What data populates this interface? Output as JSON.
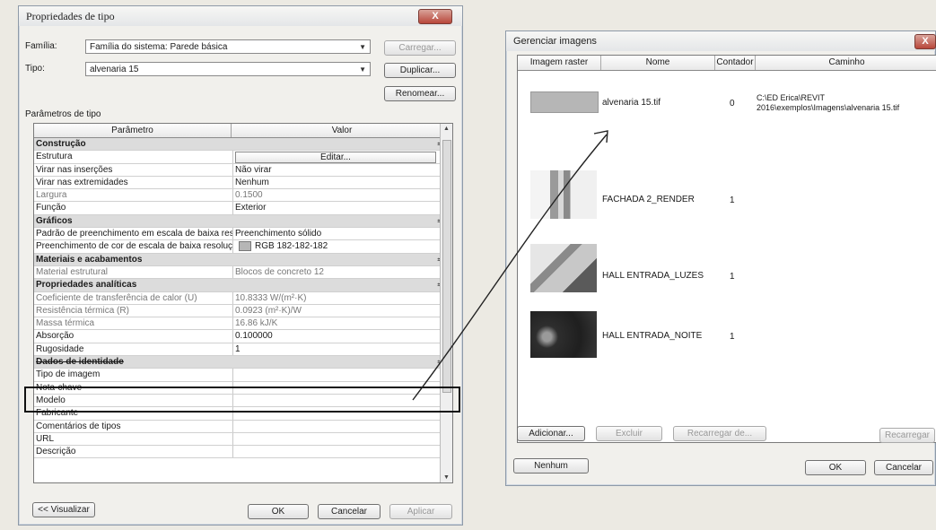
{
  "type_properties": {
    "title": "Propriedades de tipo",
    "close_label": "X",
    "family_label": "Família:",
    "family_value": "Família do sistema: Parede básica",
    "type_label": "Tipo:",
    "type_value": "alvenaria 15",
    "load_button": "Carregar...",
    "duplicate_button": "Duplicar...",
    "rename_button": "Renomear...",
    "section_label": "Parâmetros de tipo",
    "col_parameter": "Parâmetro",
    "col_value": "Valor",
    "groups": {
      "construcao": "Construção",
      "graficos": "Gráficos",
      "materiais": "Materiais e acabamentos",
      "analiticas": "Propriedades analíticas",
      "identidade": "Dados de identidade"
    },
    "rows": {
      "estrutura": {
        "p": "Estrutura",
        "v": "Editar..."
      },
      "virar_insercoes": {
        "p": "Virar nas inserções",
        "v": "Não virar"
      },
      "virar_extremidades": {
        "p": "Virar nas extremidades",
        "v": "Nenhum"
      },
      "largura": {
        "p": "Largura",
        "v": "0.1500"
      },
      "funcao": {
        "p": "Função",
        "v": "Exterior"
      },
      "padrao": {
        "p": "Padrão de preenchimento em escala de baixa res",
        "v": "Preenchimento sólido"
      },
      "cor": {
        "p": "Preenchimento de cor de escala de baixa resoluç",
        "v": "RGB 182-182-182"
      },
      "material": {
        "p": "Material estrutural",
        "v": "Blocos de concreto 12"
      },
      "coeficiente": {
        "p": "Coeficiente de transferência de calor (U)",
        "v": "10.8333 W/(m²·K)"
      },
      "resistencia": {
        "p": "Resistência térmica (R)",
        "v": "0.0923 (m²·K)/W"
      },
      "massa": {
        "p": "Massa térmica",
        "v": "16.86 kJ/K"
      },
      "absorcao": {
        "p": "Absorção",
        "v": "0.100000"
      },
      "rugosidade": {
        "p": "Rugosidade",
        "v": "1"
      },
      "tipo_imagem": {
        "p": "Tipo de imagem",
        "v": ""
      },
      "nota_chave": {
        "p": "Nota-chave",
        "v": ""
      },
      "modelo": {
        "p": "Modelo",
        "v": ""
      },
      "fabricante": {
        "p": "Fabricante",
        "v": ""
      },
      "comentarios": {
        "p": "Comentários de tipos",
        "v": ""
      },
      "url": {
        "p": "URL",
        "v": ""
      },
      "descricao": {
        "p": "Descrição",
        "v": ""
      }
    },
    "preview_button": "<< Visualizar",
    "ok_button": "OK",
    "cancel_button": "Cancelar",
    "apply_button": "Aplicar"
  },
  "image_manager": {
    "title": "Gerenciar imagens",
    "col_raster": "Imagem raster",
    "col_name": "Nome",
    "col_count": "Contador",
    "col_path": "Caminho",
    "images": [
      {
        "name": "alvenaria 15.tif",
        "count": "0",
        "path": "C:\\ED Erica\\REVIT 2016\\exemplos\\Imagens\\alvenaria 15.tif"
      },
      {
        "name": "FACHADA 2_RENDER",
        "count": "1",
        "path": ""
      },
      {
        "name": "HALL ENTRADA_LUZES",
        "count": "1",
        "path": ""
      },
      {
        "name": "HALL ENTRADA_NOITE",
        "count": "1",
        "path": ""
      }
    ],
    "add_button": "Adicionar...",
    "delete_button": "Excluir",
    "reload_from_button": "Recarregar de...",
    "reload_button": "Recarregar",
    "none_button": "Nenhum",
    "ok_button": "OK",
    "cancel_button": "Cancelar"
  }
}
